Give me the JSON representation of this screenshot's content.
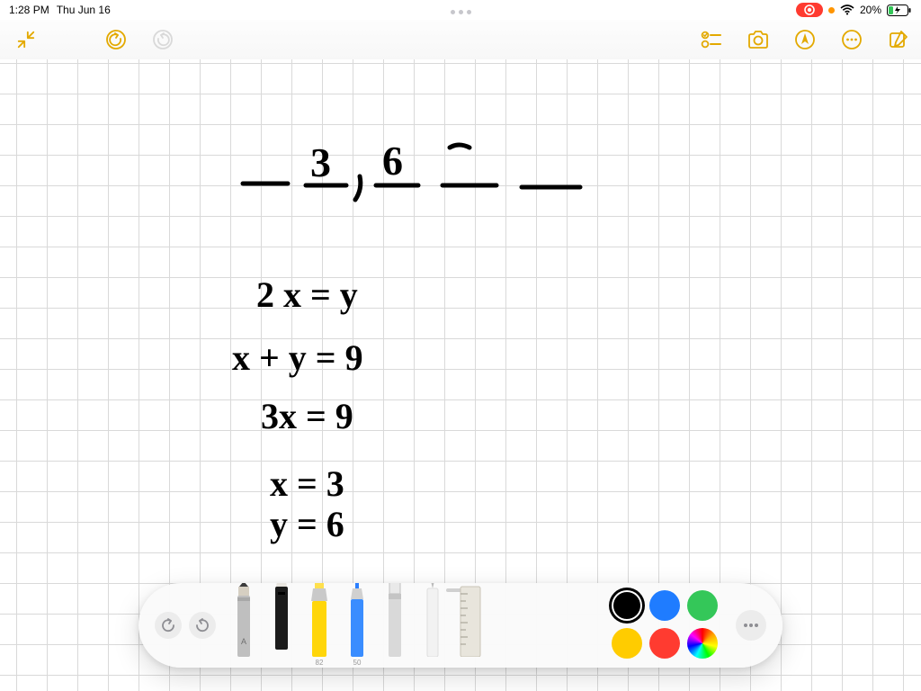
{
  "status": {
    "time": "1:28 PM",
    "date": "Thu Jun 16",
    "battery_pct": "20%"
  },
  "toolbar": {
    "collapse": "collapse",
    "undo": "undo",
    "redo": "redo",
    "checklist": "checklist",
    "camera": "camera",
    "markup": "markup",
    "more": "more",
    "compose": "compose"
  },
  "handwriting": {
    "row1": {
      "d1": "3",
      "d2": "6"
    },
    "eq1": "2 x =  y",
    "eq2": "x + y   =  9",
    "eq3": "3x   = 9",
    "eq4": "x  =  3",
    "eq5": "y  =  6"
  },
  "palette": {
    "tools": {
      "pencil": "",
      "pen": "",
      "highlighter": "82",
      "marker": "50",
      "eraser": "",
      "lasso": "",
      "ruler": ""
    },
    "pencil_letter": "A",
    "colors": {
      "black": "#000000",
      "blue": "#1f7cff",
      "green": "#34c759",
      "yellow": "#ffcc00",
      "red": "#ff3b30",
      "rainbow": "rainbow"
    },
    "selected_color": "black"
  }
}
